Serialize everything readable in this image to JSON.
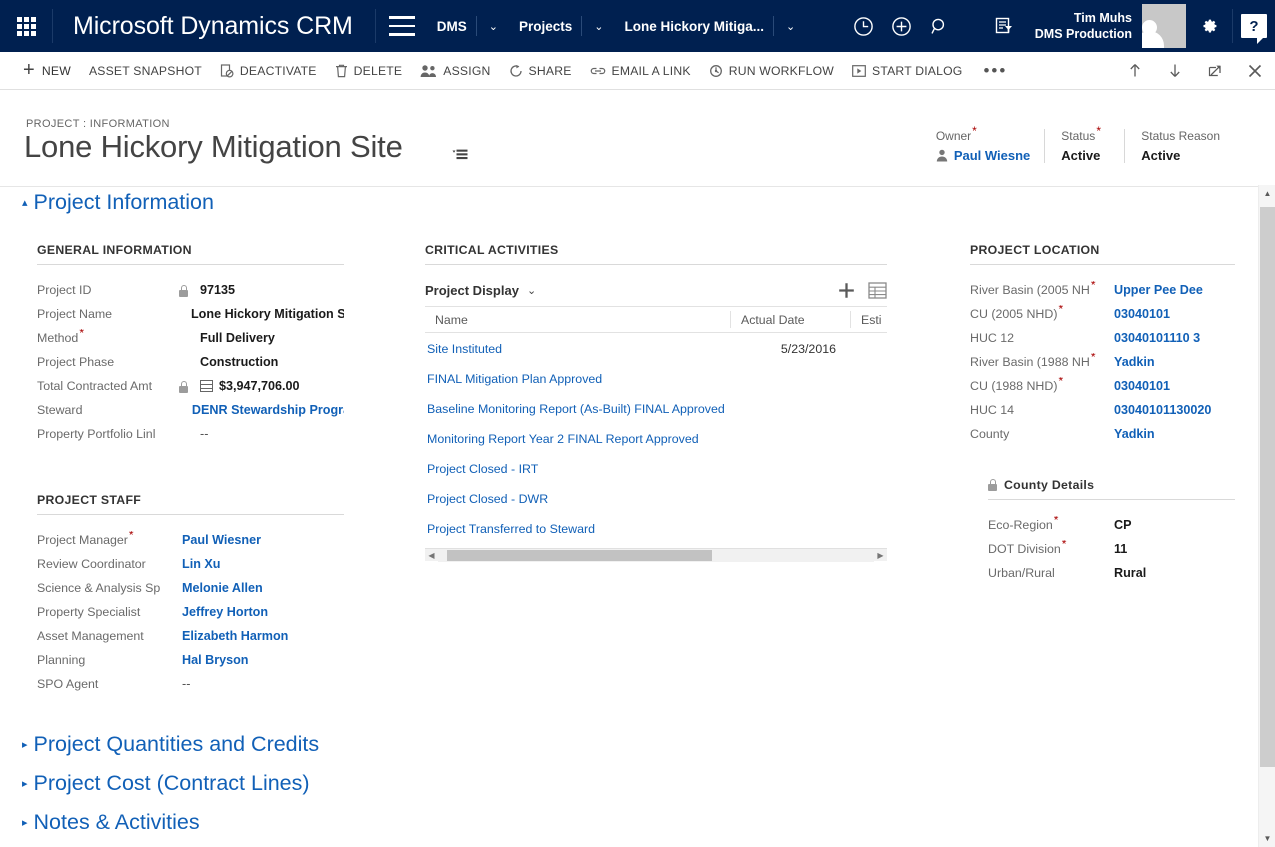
{
  "theme": {
    "nav_bg": "#002050",
    "link": "#1160b7",
    "required": "#a80000",
    "text": "#1a1a1a",
    "label": "#6a6a6a"
  },
  "navbar": {
    "waffle_icon": "waffle-grid-icon",
    "brand": "Microsoft Dynamics CRM",
    "menu_icon": "hamburger-menu-icon",
    "breadcrumb": [
      {
        "label": "DMS",
        "caret": "⌄"
      },
      {
        "label": "Projects",
        "caret": "⌄"
      },
      {
        "label": "Lone Hickory Mitiga...",
        "caret": "⌄"
      }
    ],
    "icons": [
      {
        "name": "recent-items-icon"
      },
      {
        "name": "quick-create-icon"
      },
      {
        "name": "search-icon"
      },
      {
        "name": "advanced-find-icon"
      }
    ],
    "user": {
      "name": "Tim Muhs",
      "org": "DMS Production",
      "avatar": "user-avatar"
    },
    "settings_icon": "gear-icon",
    "help_icon": "help-question-icon",
    "help_label": "?"
  },
  "commandbar": {
    "items": [
      {
        "label": "NEW",
        "icon": "plus-icon"
      },
      {
        "label": "ASSET SNAPSHOT",
        "icon": ""
      },
      {
        "label": "DEACTIVATE",
        "icon": "deactivate-icon"
      },
      {
        "label": "DELETE",
        "icon": "trash-icon"
      },
      {
        "label": "ASSIGN",
        "icon": "assign-users-icon"
      },
      {
        "label": "SHARE",
        "icon": "share-icon"
      },
      {
        "label": "EMAIL A LINK",
        "icon": "link-icon"
      },
      {
        "label": "RUN WORKFLOW",
        "icon": "workflow-icon"
      },
      {
        "label": "START DIALOG",
        "icon": "play-icon"
      }
    ],
    "overflow_label": "•••",
    "right_icons": [
      {
        "name": "previous-record-icon",
        "glyph": "↑"
      },
      {
        "name": "next-record-icon",
        "glyph": "↓"
      },
      {
        "name": "popout-icon",
        "glyph": "↗"
      },
      {
        "name": "close-icon",
        "glyph": "✕"
      }
    ]
  },
  "record": {
    "breadcrumb_label": "PROJECT : INFORMATION",
    "title": "Lone Hickory Mitigation Site",
    "title_flyout_icon": "form-selector-icon",
    "header_fields": [
      {
        "label": "Owner",
        "required": true,
        "value": "Paul Wiesne",
        "link": true,
        "icon": "person-icon"
      },
      {
        "label": "Status",
        "required": true,
        "value": "Active",
        "link": false
      },
      {
        "label": "Status Reason",
        "required": false,
        "value": "Active",
        "link": false
      }
    ]
  },
  "sections": {
    "project_information": {
      "label": "Project Information",
      "expanded": true,
      "caret": "▴"
    },
    "collapsed": [
      {
        "label": "Project Quantities and Credits",
        "caret": "▸"
      },
      {
        "label": "Project Cost (Contract Lines)",
        "caret": "▸"
      },
      {
        "label": "Notes & Activities",
        "caret": "▸"
      }
    ]
  },
  "general_information": {
    "title": "GENERAL INFORMATION",
    "rows": [
      {
        "label": "Project ID",
        "required": false,
        "locked": true,
        "value": "97135",
        "link": false
      },
      {
        "label": "Project Name",
        "required": false,
        "locked": false,
        "value": "Lone Hickory Mitigation Sit",
        "link": false
      },
      {
        "label": "Method",
        "required": true,
        "locked": false,
        "value": "Full Delivery",
        "link": false
      },
      {
        "label": "Project Phase",
        "required": false,
        "locked": false,
        "value": "Construction",
        "link": false
      },
      {
        "label": "Total Contracted Amt",
        "required": false,
        "locked": true,
        "money": true,
        "value": "$3,947,706.00",
        "link": false
      },
      {
        "label": "Steward",
        "required": false,
        "locked": false,
        "value": "DENR Stewardship Program",
        "link": true
      },
      {
        "label": "Property Portfolio Linl",
        "required": false,
        "locked": false,
        "value": "--",
        "link": false,
        "muted": true
      }
    ]
  },
  "project_staff": {
    "title": "PROJECT STAFF",
    "rows": [
      {
        "label": "Project Manager",
        "required": true,
        "value": "Paul Wiesner",
        "link": true
      },
      {
        "label": "Review Coordinator",
        "required": false,
        "value": "Lin Xu",
        "link": true
      },
      {
        "label": "Science & Analysis Sp",
        "required": false,
        "value": "Melonie Allen",
        "link": true
      },
      {
        "label": "Property Specialist",
        "required": false,
        "value": "Jeffrey Horton",
        "link": true
      },
      {
        "label": "Asset Management",
        "required": false,
        "value": "Elizabeth Harmon",
        "link": true
      },
      {
        "label": "Planning",
        "required": false,
        "value": "Hal Bryson",
        "link": true
      },
      {
        "label": "SPO Agent",
        "required": false,
        "value": "--",
        "link": false,
        "muted": true
      }
    ]
  },
  "critical_activities": {
    "title": "CRITICAL ACTIVITIES",
    "view_name": "Project Display",
    "view_caret": "⌄",
    "add_icon": "add-new-record-icon",
    "grid_icon": "open-grid-icon",
    "columns": [
      {
        "label": "Name"
      },
      {
        "label": "Actual Date"
      },
      {
        "label": "Esti"
      }
    ],
    "rows": [
      {
        "name": "Site Instituted",
        "actual_date": "5/23/2016"
      },
      {
        "name": "FINAL Mitigation Plan Approved",
        "actual_date": ""
      },
      {
        "name": "Baseline Monitoring Report (As-Built) FINAL Approved",
        "actual_date": ""
      },
      {
        "name": "Monitoring Report Year 2 FINAL Report Approved",
        "actual_date": ""
      },
      {
        "name": "Project Closed - IRT",
        "actual_date": ""
      },
      {
        "name": "Project Closed - DWR",
        "actual_date": ""
      },
      {
        "name": "Project Transferred to Steward",
        "actual_date": ""
      }
    ],
    "scroll_left_icon": "scroll-left-icon",
    "scroll_right_icon": "scroll-right-icon"
  },
  "project_location": {
    "title": "PROJECT LOCATION",
    "rows": [
      {
        "label": "River Basin (2005 NH",
        "required": true,
        "value": "Upper Pee Dee",
        "link": true
      },
      {
        "label": "CU (2005 NHD)",
        "required": true,
        "value": "03040101",
        "link": true
      },
      {
        "label": "HUC 12",
        "required": false,
        "value": "03040101110 3",
        "link": true
      },
      {
        "label": "River Basin (1988 NH",
        "required": true,
        "value": "Yadkin",
        "link": true
      },
      {
        "label": "CU (1988 NHD)",
        "required": true,
        "value": "03040101",
        "link": true
      },
      {
        "label": "HUC 14",
        "required": false,
        "value": "03040101130020",
        "link": true
      },
      {
        "label": "County",
        "required": false,
        "value": "Yadkin",
        "link": true
      }
    ]
  },
  "county_details": {
    "title": "County Details",
    "locked": true,
    "rows": [
      {
        "label": "Eco-Region",
        "required": true,
        "value": "CP"
      },
      {
        "label": "DOT Division",
        "required": true,
        "value": "11"
      },
      {
        "label": "Urban/Rural",
        "required": false,
        "value": "Rural"
      }
    ]
  },
  "scrollbars": {
    "page_up_icon": "scroll-up-icon",
    "page_down_icon": "scroll-down-icon"
  }
}
